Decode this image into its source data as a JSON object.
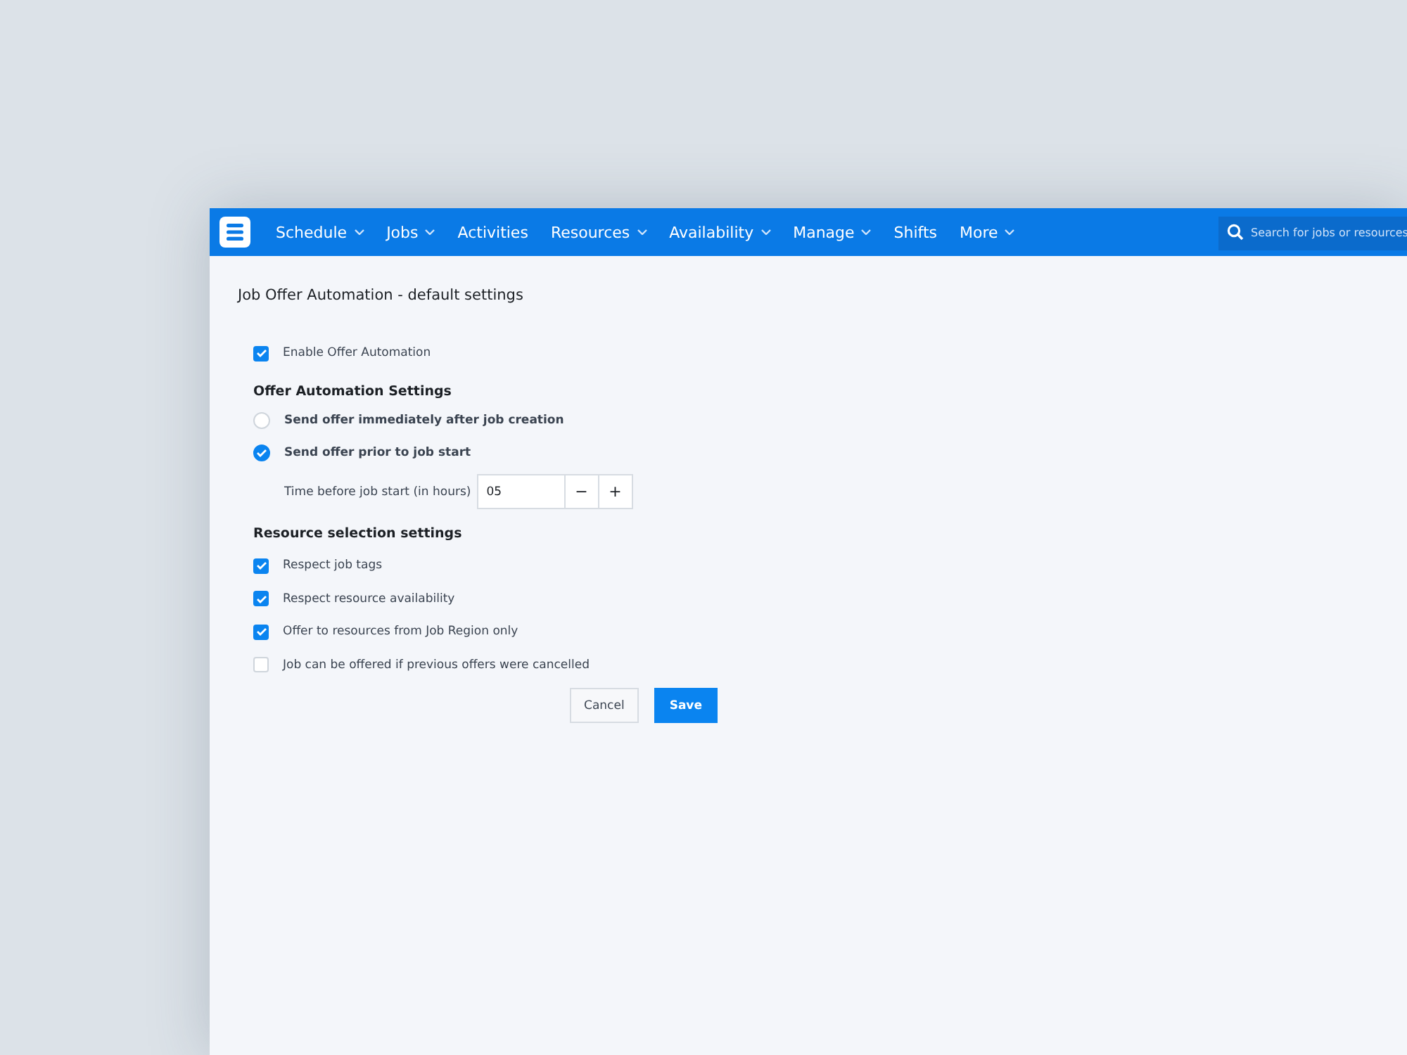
{
  "nav": {
    "items": [
      {
        "label": "Schedule",
        "dropdown": true
      },
      {
        "label": "Jobs",
        "dropdown": true
      },
      {
        "label": "Activities",
        "dropdown": false
      },
      {
        "label": "Resources",
        "dropdown": true
      },
      {
        "label": "Availability",
        "dropdown": true
      },
      {
        "label": "Manage",
        "dropdown": true
      },
      {
        "label": "Shifts",
        "dropdown": false
      },
      {
        "label": "More",
        "dropdown": true
      }
    ],
    "search": {
      "placeholder": "Search for jobs or resources"
    }
  },
  "page_title": "Job Offer Automation - default settings",
  "enable": {
    "label": "Enable Offer Automation",
    "checked": true
  },
  "offer_section": {
    "heading": "Offer Automation Settings",
    "options": [
      {
        "label": "Send offer immediately after job creation",
        "selected": false
      },
      {
        "label": "Send offer prior to job start",
        "selected": true
      }
    ],
    "hours": {
      "label": "Time before job start (in hours)",
      "value": "05",
      "minus": "−",
      "plus": "+"
    }
  },
  "resource_section": {
    "heading": "Resource selection settings",
    "options": [
      {
        "label": "Respect job tags",
        "checked": true
      },
      {
        "label": "Respect resource availability",
        "checked": true
      },
      {
        "label": "Offer to resources from Job Region only",
        "checked": true
      },
      {
        "label": "Job can be offered if previous offers were cancelled",
        "checked": false
      }
    ]
  },
  "buttons": {
    "cancel": "Cancel",
    "save": "Save"
  }
}
